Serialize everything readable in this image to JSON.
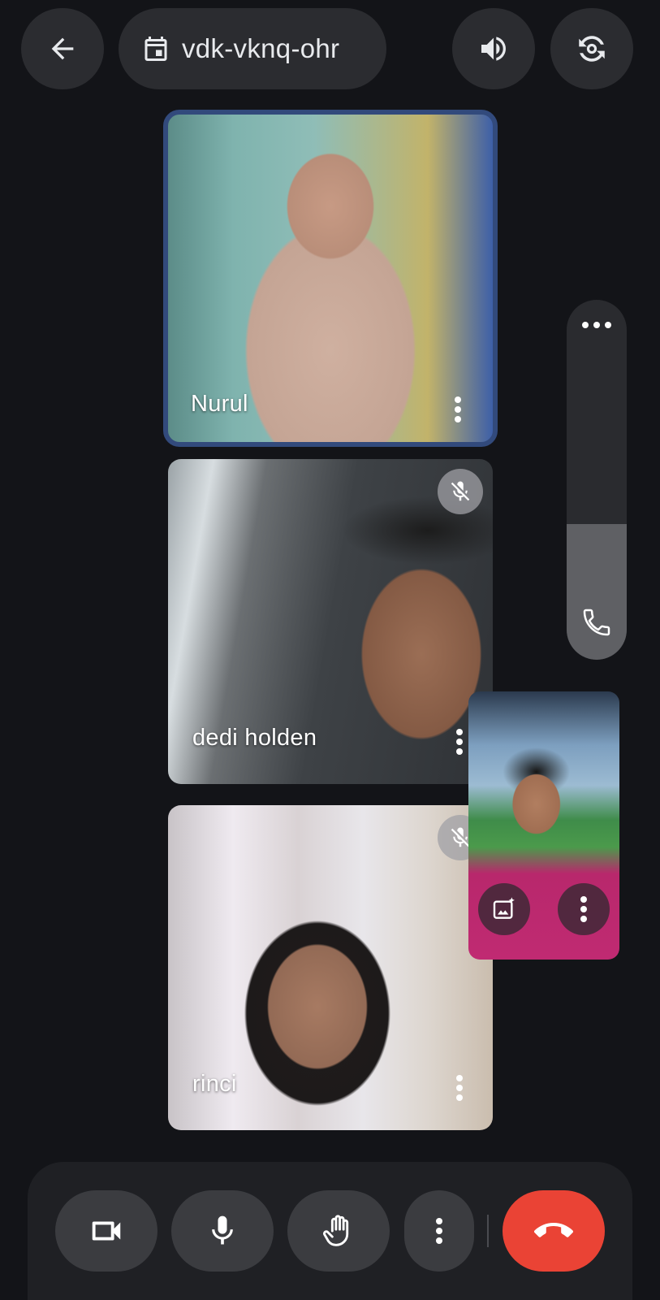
{
  "header": {
    "meeting_code": "vdk-vknq-ohr",
    "icons": [
      "arrow-left-icon",
      "calendar-icon",
      "volume-icon",
      "switch-camera-icon"
    ]
  },
  "participants": [
    {
      "name": "Nurul",
      "muted": false,
      "active_speaker": true
    },
    {
      "name": "dedi holden",
      "muted": true,
      "active_speaker": false
    },
    {
      "name": "rinci",
      "muted": true,
      "active_speaker": false
    }
  ],
  "self_view": {
    "buttons": [
      "effects-icon",
      "more-vert-icon"
    ]
  },
  "side_panel": {
    "icons": [
      "more-horiz-icon",
      "phone-icon"
    ]
  },
  "controls": {
    "buttons": [
      "camera-icon",
      "microphone-icon",
      "raise-hand-icon",
      "more-vert-icon",
      "end-call-icon"
    ],
    "end_call_color": "#ea4335",
    "active_speaker_border": "#324a7c"
  }
}
